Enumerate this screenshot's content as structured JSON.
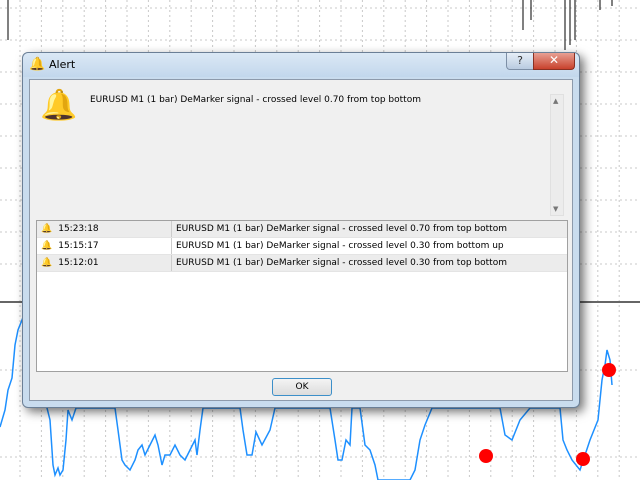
{
  "dialog": {
    "title": "Alert",
    "help_label": "?",
    "close_label": "✕",
    "message": "EURUSD M1 (1 bar) DeMarker signal - crossed level 0.70 from top bottom",
    "ok_label": "OK"
  },
  "alerts": [
    {
      "time": "15:23:18",
      "text": "EURUSD M1 (1 bar) DeMarker signal - crossed level 0.70 from top bottom"
    },
    {
      "time": "15:15:17",
      "text": "EURUSD M1 (1 bar) DeMarker signal - crossed level 0.30 from bottom up"
    },
    {
      "time": "15:12:01",
      "text": "EURUSD M1 (1 bar) DeMarker signal - crossed level 0.30 from top bottom"
    }
  ],
  "colors": {
    "indicator": "#1e90ff",
    "signal": "#ff0000"
  }
}
